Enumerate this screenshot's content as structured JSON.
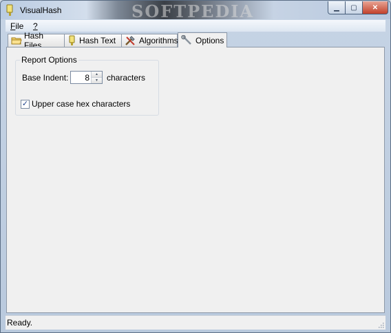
{
  "window": {
    "title": "VisualHash",
    "watermark": "SOFTPEDIA",
    "controls": {
      "minimize": "▁",
      "maximize": "▢",
      "close": "✕"
    }
  },
  "menu": {
    "items": [
      {
        "label": "File",
        "accel": "F",
        "rest": "ile"
      },
      {
        "label": "?",
        "accel": "?",
        "rest": ""
      }
    ]
  },
  "tabs": [
    {
      "label": "Hash Files",
      "icon": "folder-icon",
      "active": false
    },
    {
      "label": "Hash Text",
      "icon": "text-icon",
      "active": false
    },
    {
      "label": "Algorithms",
      "icon": "tools-icon",
      "active": false
    },
    {
      "label": "Options",
      "icon": "wrench-icon",
      "active": true
    }
  ],
  "options": {
    "group_title": "Report Options",
    "base_indent_label": "Base Indent:",
    "base_indent_value": "8",
    "characters_label": "characters",
    "uppercase_label": "Upper case hex characters",
    "uppercase_checked": true
  },
  "status": {
    "text": "Ready."
  }
}
